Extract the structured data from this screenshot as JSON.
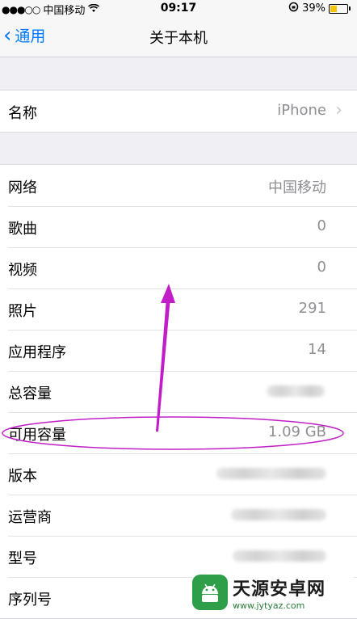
{
  "status_bar": {
    "signal": "●●●○○",
    "carrier": "中国移动",
    "time": "09:17",
    "battery_percent": "39%",
    "battery_level": 0.39
  },
  "nav": {
    "back_label": "通用",
    "title": "关于本机"
  },
  "name_row": {
    "label": "名称",
    "value": "iPhone"
  },
  "info_rows": [
    {
      "label": "网络",
      "value": "中国移动"
    },
    {
      "label": "歌曲",
      "value": "0"
    },
    {
      "label": "视频",
      "value": "0"
    },
    {
      "label": "照片",
      "value": "291"
    },
    {
      "label": "应用程序",
      "value": "14"
    },
    {
      "label": "总容量",
      "value": ""
    },
    {
      "label": "可用容量",
      "value": "1.09 GB"
    },
    {
      "label": "版本",
      "value": ""
    },
    {
      "label": "运营商",
      "value": ""
    },
    {
      "label": "型号",
      "value": ""
    },
    {
      "label": "序列号",
      "value": ""
    }
  ],
  "watermark": {
    "name": "天源安卓网",
    "url": "www.jytyaz.com"
  },
  "colors": {
    "accent": "#007aff",
    "annotation": "#c21ec8",
    "battery": "#f5c400"
  }
}
